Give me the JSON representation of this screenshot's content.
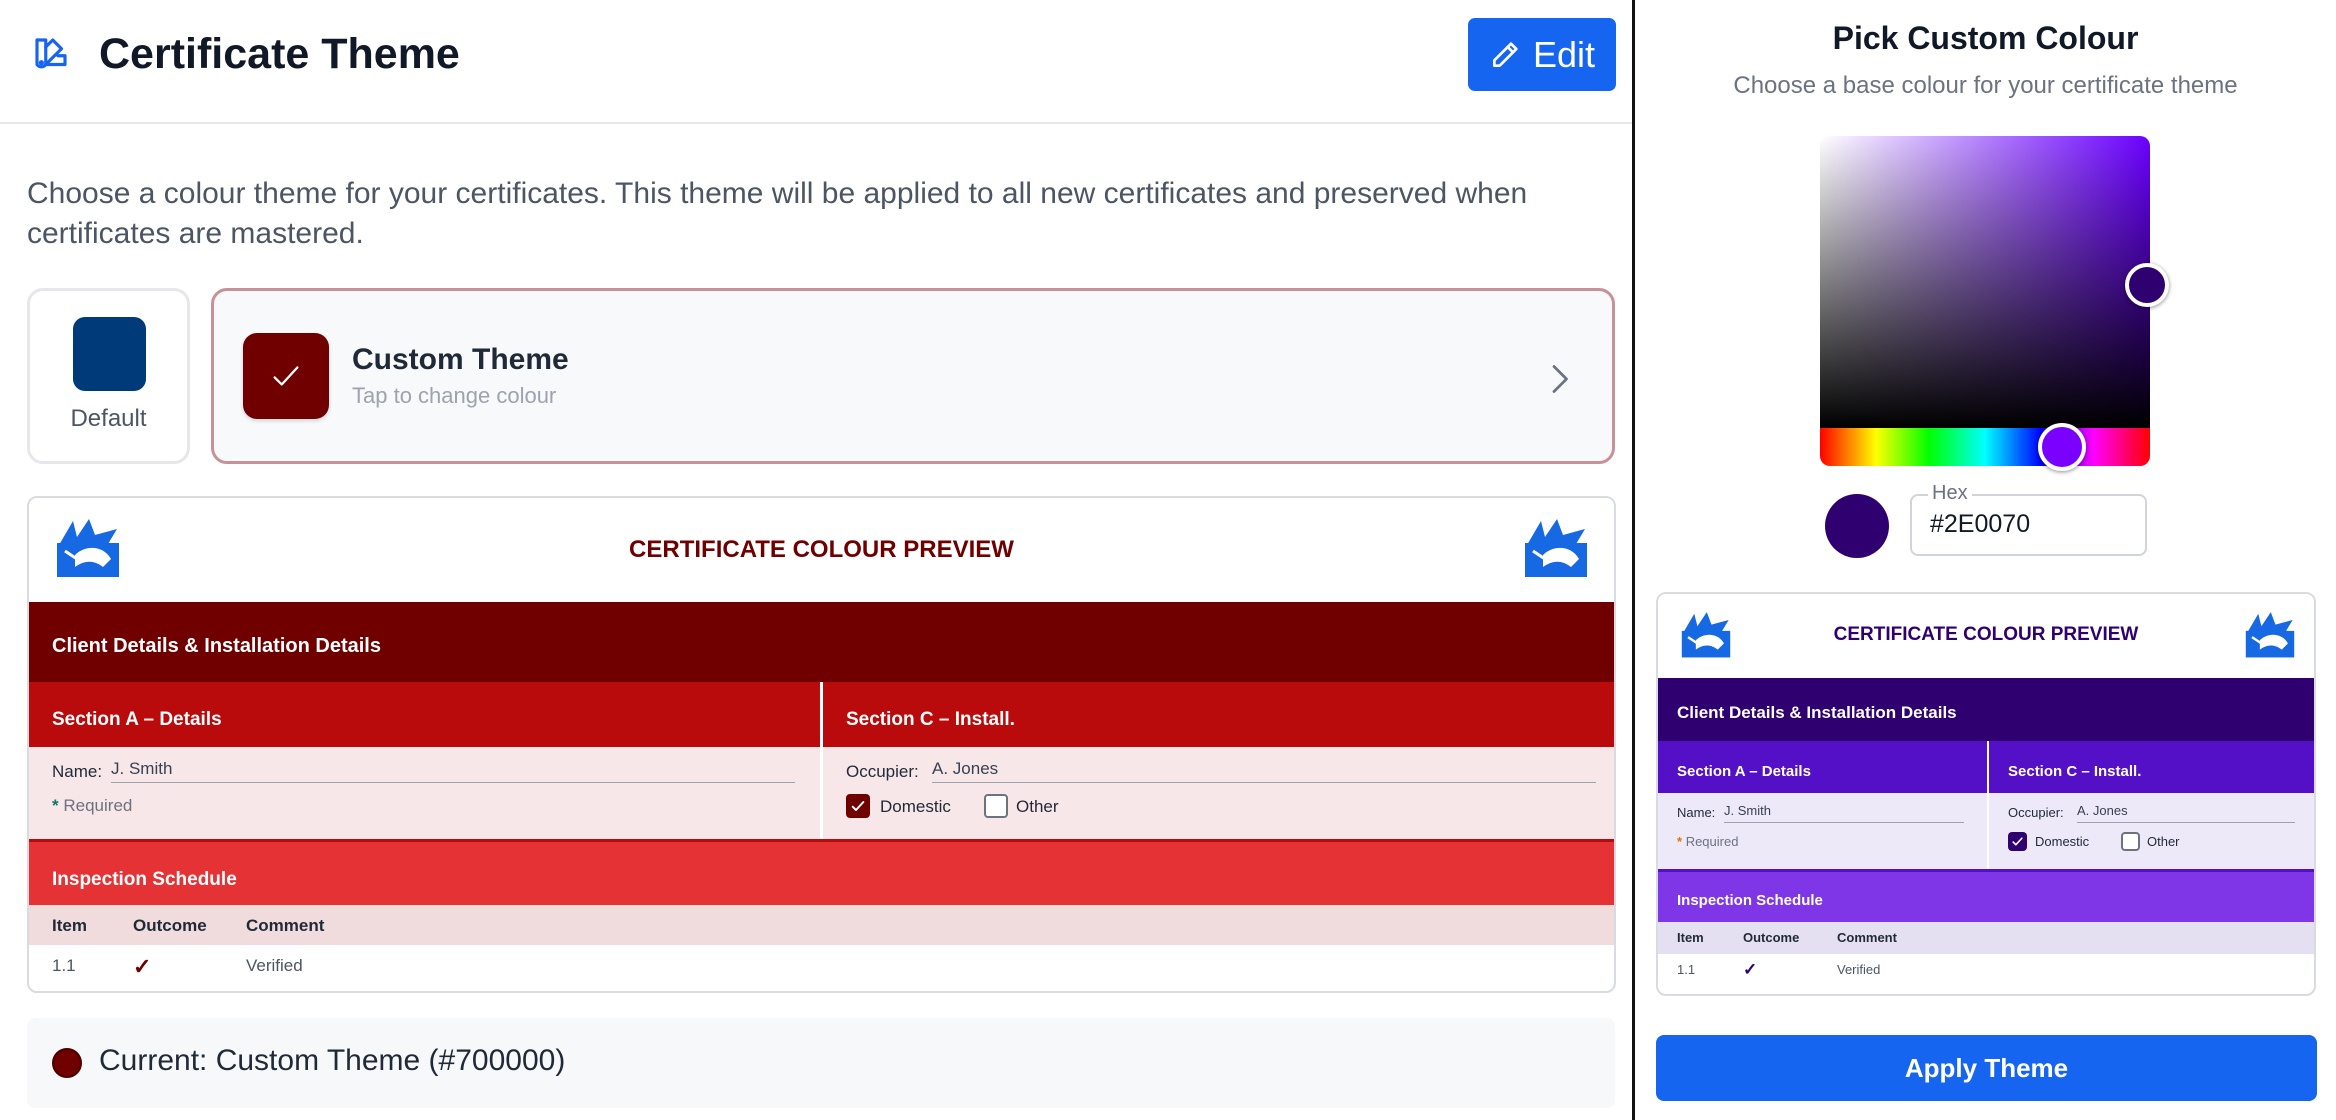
{
  "header": {
    "title": "Certificate Theme",
    "edit_label": "Edit"
  },
  "intro": "Choose a colour theme for your certificates. This theme will be applied to all new certificates and preserved when certificates are mastered.",
  "themes": {
    "default_label": "Default",
    "default_color": "#003A78",
    "custom_title": "Custom Theme",
    "custom_subtitle": "Tap to change colour",
    "custom_color": "#700000"
  },
  "preview": {
    "title": "CERTIFICATE COLOUR PREVIEW",
    "band_title": "Client Details & Installation Details",
    "section_a": "Section A – Details",
    "section_c": "Section C – Install.",
    "name_label": "Name:",
    "name_value": "J. Smith",
    "required_star": "*",
    "required_text": "Required",
    "occupier_label": "Occupier:",
    "occupier_value": "A. Jones",
    "domestic_label": "Domestic",
    "other_label": "Other",
    "inspection_title": "Inspection Schedule",
    "table_headers": [
      "Item",
      "Outcome",
      "Comment"
    ],
    "table_row": {
      "item": "1.1",
      "outcome": "✓",
      "comment": "Verified"
    }
  },
  "current": {
    "text": "Current: Custom Theme (#700000)"
  },
  "picker": {
    "title": "Pick Custom Colour",
    "subtitle": "Choose a base colour for your certificate theme",
    "hex_label": "Hex",
    "hex_value": "#2E0070",
    "apply_label": "Apply Theme"
  },
  "colors": {
    "accent_blue": "#1565F0",
    "left_dark": "#700000",
    "left_mid": "#B90B0B",
    "left_bright": "#E53234",
    "left_pale": "#F8E7E8",
    "left_table": "#F1DCDD",
    "right_dark": "#2E0070",
    "right_mid": "#5410C6",
    "right_bright": "#7F36E6",
    "right_pale": "#EEE9F8",
    "right_table": "#E5E0F1"
  }
}
